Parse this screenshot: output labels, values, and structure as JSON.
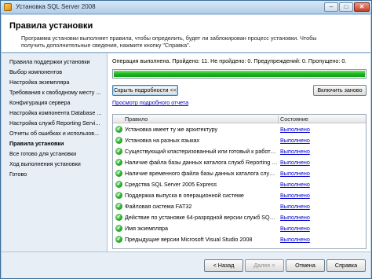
{
  "window": {
    "title": "Установка SQL Server 2008",
    "minimize_glyph": "–",
    "maximize_glyph": "□",
    "close_glyph": "✕"
  },
  "header": {
    "title": "Правила установки",
    "description": "Программа установки выполняет правила, чтобы определить, будет ли заблокирован процесс установки. Чтобы получить дополнительные сведения, нажмите кнопку \"Справка\"."
  },
  "nav": {
    "items": [
      {
        "label": "Правила поддержки установки",
        "active": false
      },
      {
        "label": "Выбор компонентов",
        "active": false
      },
      {
        "label": "Настройка экземпляра",
        "active": false
      },
      {
        "label": "Требования к свободному месту ...",
        "active": false
      },
      {
        "label": "Конфигурация сервера",
        "active": false
      },
      {
        "label": "Настройка компонента Database ...",
        "active": false
      },
      {
        "label": "Настройка служб Reporting Servi...",
        "active": false
      },
      {
        "label": "Отчеты об ошибках и использов...",
        "active": false
      },
      {
        "label": "Правила установки",
        "active": true
      },
      {
        "label": "Все готово для установки",
        "active": false
      },
      {
        "label": "Ход выполнения установки",
        "active": false
      },
      {
        "label": "Готово",
        "active": false
      }
    ]
  },
  "main": {
    "status": "Операция выполнена. Пройдено: 11. Не пройдено: 0. Предупреждений: 0. Пропущено: 0.",
    "progress_fraction": 1.0,
    "hide_details_label": "Скрыть подробности <<",
    "rerun_label": "Включить заново",
    "report_link": "Просмотр подробного отчета",
    "table": {
      "col_rule": "Правило",
      "col_state": "Состояние",
      "rows": [
        {
          "rule": "Установка имеет ту же архитектуру",
          "state": "Выполнено"
        },
        {
          "rule": "Установка на разных языках",
          "state": "Выполнено"
        },
        {
          "rule": "Существующий кластеризованный или готовый к работе в ...",
          "state": "Выполнено"
        },
        {
          "rule": "Наличие файла базы данных каталога служб Reporting Servi...",
          "state": "Выполнено"
        },
        {
          "rule": "Наличие временного файла базы данных каталога служб R...",
          "state": "Выполнено"
        },
        {
          "rule": "Средства SQL Server 2005 Express",
          "state": "Выполнено"
        },
        {
          "rule": "Поддержка выпуска в операционной системе",
          "state": "Выполнено"
        },
        {
          "rule": "Файловая система FAT32",
          "state": "Выполнено"
        },
        {
          "rule": "Действие по установке 64-разрядной версии служб SQL Server...",
          "state": "Выполнено"
        },
        {
          "rule": "Имя экземпляра",
          "state": "Выполнено"
        },
        {
          "rule": "Предыдущие версии Microsoft Visual Studio 2008",
          "state": "Выполнено"
        }
      ]
    }
  },
  "footer": {
    "back_label": "< Назад",
    "next_label": "Далее >",
    "cancel_label": "Отмена",
    "help_label": "Справка"
  }
}
